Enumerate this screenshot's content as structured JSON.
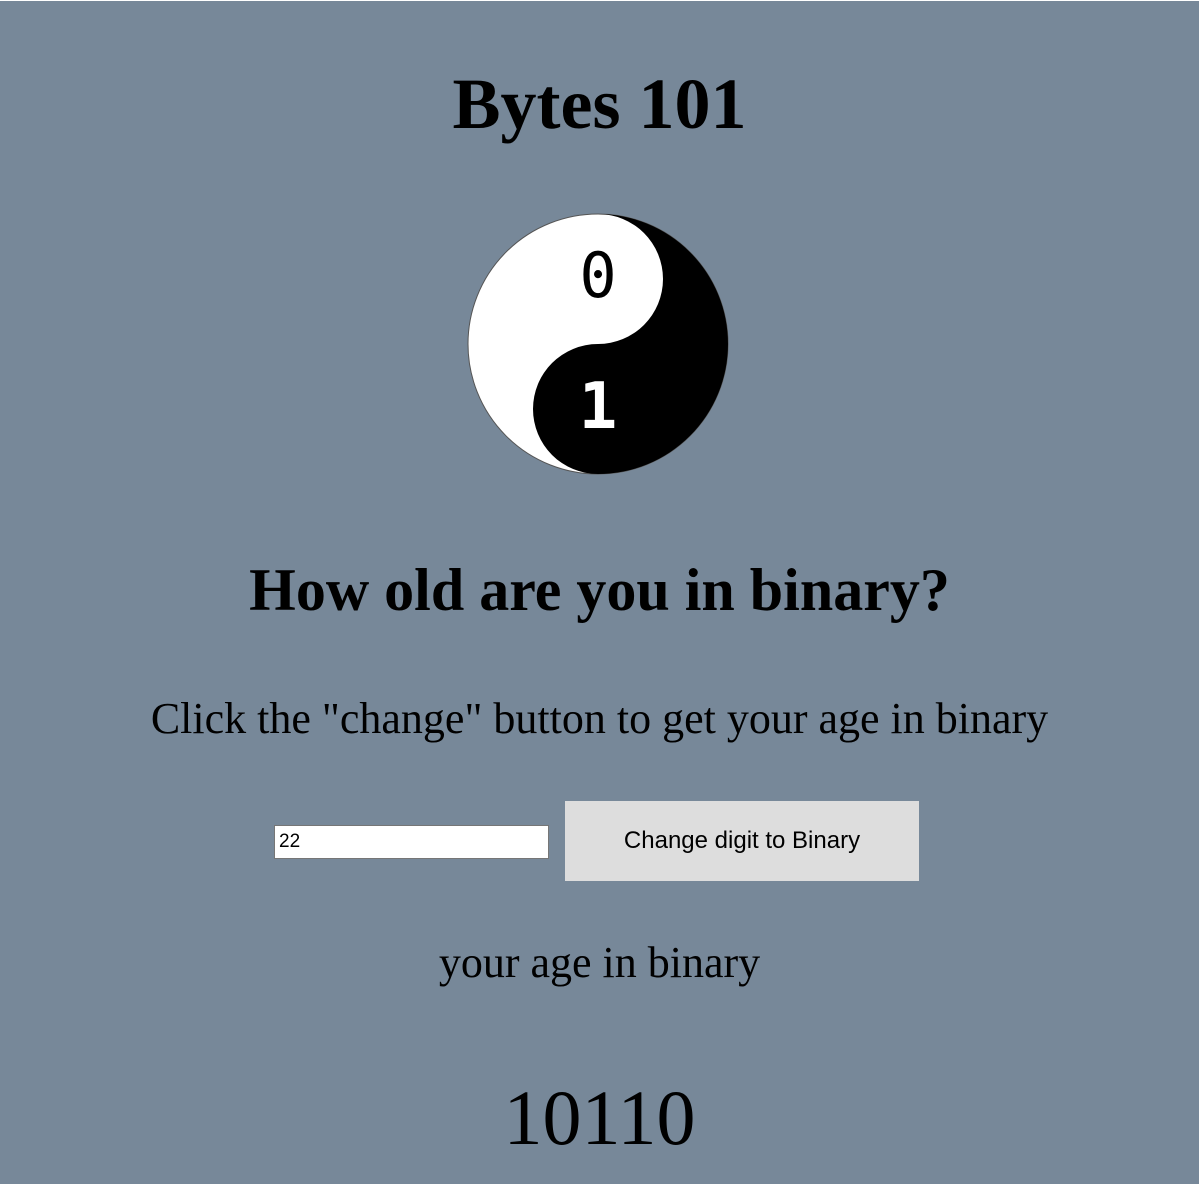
{
  "header": {
    "title": "Bytes 101"
  },
  "logo": {
    "icon": "yin-yang-binary-icon",
    "top_digit": "0",
    "bottom_digit": "1",
    "colors": {
      "light": "#ffffff",
      "dark": "#000000"
    }
  },
  "main": {
    "question": "How old are you in binary?",
    "instruction": "Click the \"change\" button to get your age in binary",
    "age_input_value": "22",
    "button_label": "Change digit to Binary",
    "result_label": "your age in binary",
    "result_value": "10110"
  },
  "colors": {
    "background": "#778899",
    "button_background": "#dddddd"
  }
}
